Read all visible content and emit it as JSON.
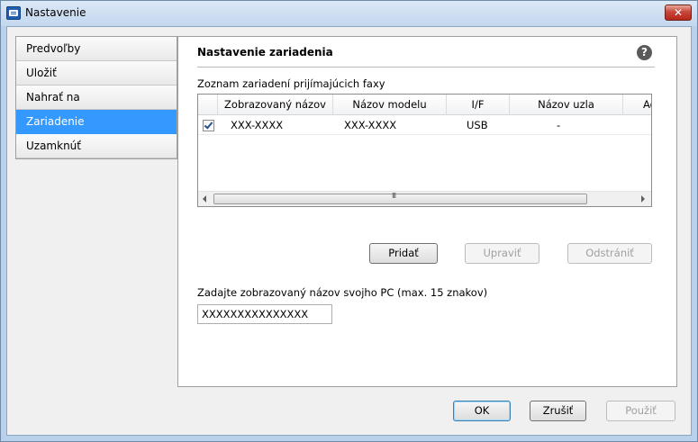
{
  "window": {
    "title": "Nastavenie",
    "close_label": "✕"
  },
  "sidebar": {
    "items": [
      {
        "label": "Predvoľby"
      },
      {
        "label": "Uložiť"
      },
      {
        "label": "Nahrať na"
      },
      {
        "label": "Zariadenie",
        "active": true
      },
      {
        "label": "Uzamknúť"
      }
    ]
  },
  "panel": {
    "title": "Nastavenie zariadenia",
    "help_label": "?",
    "list_label": "Zoznam zariadení prijímajúcich faxy",
    "columns": [
      "Zobrazovaný názov",
      "Názov modelu",
      "I/F",
      "Názov uzla",
      "Ad"
    ],
    "rows": [
      {
        "checked": true,
        "display_name": "XXX-XXXX",
        "model": "XXX-XXXX",
        "interface": "USB",
        "node": "-"
      }
    ],
    "scroll_grip": "III",
    "add_label": "Pridať",
    "edit_label": "Upraviť",
    "delete_label": "Odstrániť",
    "pc_name_label": "Zadajte zobrazovaný názov svojho PC (max. 15 znakov)",
    "pc_name_value": "XXXXXXXXXXXXXXX"
  },
  "footer": {
    "ok_label": "OK",
    "cancel_label": "Zrušiť",
    "apply_label": "Použiť"
  },
  "colors": {
    "selection": "#3399ff",
    "window_frame": "#b9d1ea",
    "close_button": "#c7463a"
  },
  "icons": {
    "app": "settings-window-icon",
    "help": "help-icon",
    "close": "close-icon"
  }
}
